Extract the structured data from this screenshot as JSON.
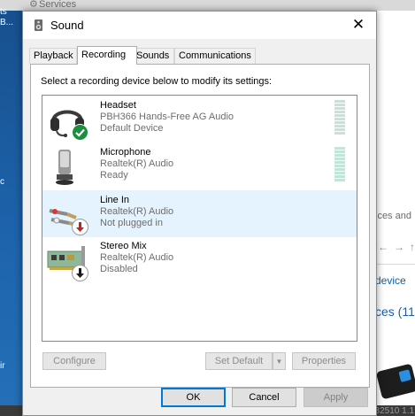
{
  "background": {
    "top_window_title": "Services",
    "left_snippets": [
      "ts",
      "B...",
      "c",
      "ir"
    ],
    "right_text": {
      "devices_and": "ices and",
      "device_link": "device",
      "devices_heading": "ces (11",
      "bottom": "CCB2510 1.1"
    }
  },
  "dialog": {
    "title": "Sound",
    "close_glyph": "✕",
    "tabs": [
      {
        "label": "Playback"
      },
      {
        "label": "Recording"
      },
      {
        "label": "Sounds"
      },
      {
        "label": "Communications"
      }
    ],
    "active_tab": "Recording",
    "instructions": "Select a recording device below to modify its settings:",
    "devices": [
      {
        "name": "Headset",
        "driver": "PBH366 Hands-Free AG Audio",
        "status": "Default Device",
        "icon": "headset-icon",
        "badge": "checkmark-badge-icon",
        "meter": true
      },
      {
        "name": "Microphone",
        "driver": "Realtek(R) Audio",
        "status": "Ready",
        "icon": "microphone-icon",
        "badge": null,
        "meter": true
      },
      {
        "name": "Line In",
        "driver": "Realtek(R) Audio",
        "status": "Not plugged in",
        "icon": "line-in-jack-icon",
        "badge": "unplugged-arrow-badge-icon",
        "meter": false
      },
      {
        "name": "Stereo Mix",
        "driver": "Realtek(R) Audio",
        "status": "Disabled",
        "icon": "sound-card-icon",
        "badge": "disabled-arrow-badge-icon",
        "meter": false
      }
    ],
    "selected_device": "Line In",
    "buttons": {
      "configure": "Configure",
      "set_default": "Set Default",
      "properties": "Properties",
      "ok": "OK",
      "cancel": "Cancel",
      "apply": "Apply"
    }
  },
  "colors": {
    "accent": "#0078d7",
    "selected_row": "#e5f3ff",
    "check_badge": "#1a8f3e",
    "unplugged_badge": "#cc1e1e"
  }
}
